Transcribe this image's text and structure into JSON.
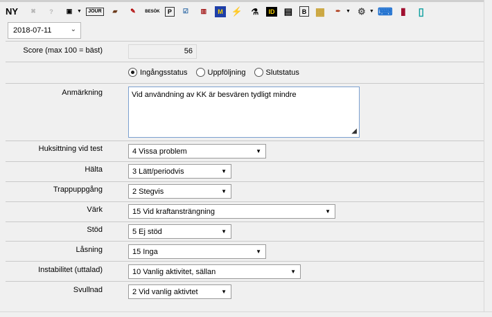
{
  "toolbar": {
    "new_label": "NY",
    "icons": [
      {
        "name": "stop-icon",
        "glyph": "✖"
      },
      {
        "name": "help-icon",
        "glyph": "?"
      },
      {
        "name": "save-icon",
        "glyph": "▣"
      },
      {
        "name": "journal-icon",
        "glyph": "JOUR"
      },
      {
        "name": "briefcase-icon",
        "glyph": "▰"
      },
      {
        "name": "edit-icon",
        "glyph": "✎"
      },
      {
        "name": "visit-icon",
        "glyph": "BESÖK"
      },
      {
        "name": "p-icon",
        "glyph": "P"
      },
      {
        "name": "checklist-icon",
        "glyph": "☑"
      },
      {
        "name": "chart-icon",
        "glyph": "▥"
      },
      {
        "name": "m-icon",
        "glyph": "M"
      },
      {
        "name": "lightning-icon",
        "glyph": "⚡"
      },
      {
        "name": "lab-icon",
        "glyph": "⚗"
      },
      {
        "name": "id-icon",
        "glyph": "ID"
      },
      {
        "name": "document-icon",
        "glyph": "▤"
      },
      {
        "name": "b-icon",
        "glyph": "B"
      },
      {
        "name": "map-icon",
        "glyph": "▦"
      },
      {
        "name": "syringe-icon",
        "glyph": "✒"
      },
      {
        "name": "gears-icon",
        "glyph": "⚙"
      },
      {
        "name": "keyboard-icon",
        "glyph": "⌨"
      },
      {
        "name": "book-icon",
        "glyph": "▮"
      },
      {
        "name": "phone-icon",
        "glyph": "▯"
      }
    ]
  },
  "date": {
    "value": "2018-07-11"
  },
  "score": {
    "label": "Score (max 100 = bäst)",
    "value": "56"
  },
  "status": {
    "options": [
      "Ingångsstatus",
      "Uppföljning",
      "Slutstatus"
    ],
    "selected_index": 0
  },
  "remark": {
    "label": "Anmärkning",
    "value": "Vid användning av KK är besvären tydligt mindre"
  },
  "fields": [
    {
      "label": "Huksittning vid test",
      "value": "4  Vissa problem"
    },
    {
      "label": "Hälta",
      "value": "3  Lätt/periodvis"
    },
    {
      "label": "Trappuppgång",
      "value": "2  Stegvis"
    },
    {
      "label": "Värk",
      "value": "15  Vid kraftansträngning"
    },
    {
      "label": "Stöd",
      "value": "5  Ej stöd"
    },
    {
      "label": "Låsning",
      "value": "15  Inga"
    },
    {
      "label": "Instabilitet (uttalad)",
      "value": "10  Vanlig aktivitet, sällan"
    },
    {
      "label": "Svullnad",
      "value": "2  Vid vanlig aktivtet"
    }
  ]
}
